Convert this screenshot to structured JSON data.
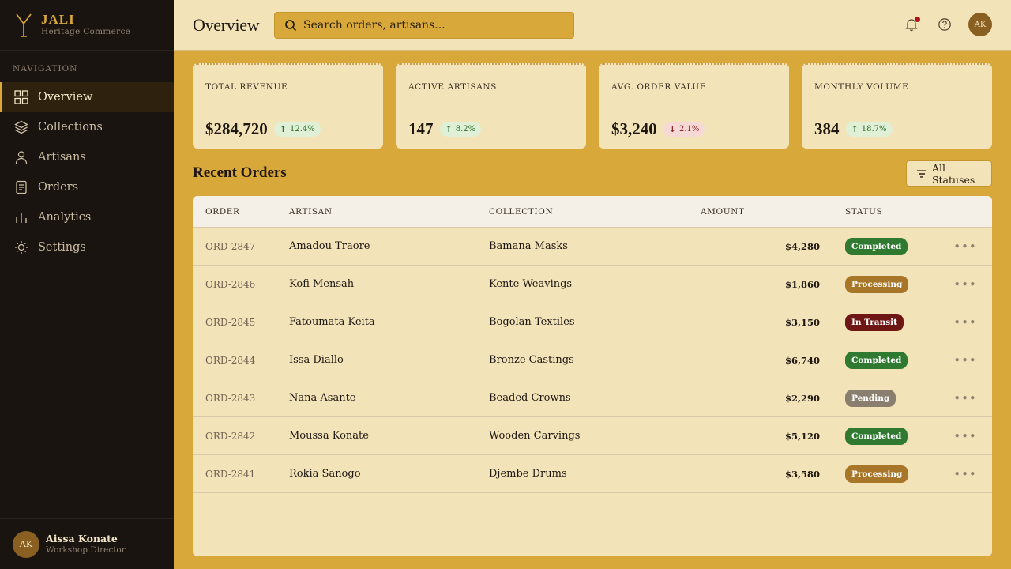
{
  "brand": {
    "name": "JALI",
    "subtitle": "Heritage Commerce"
  },
  "sidebar": {
    "heading": "NAVIGATION",
    "items": [
      {
        "label": "Overview",
        "icon": "grid-icon"
      },
      {
        "label": "Collections",
        "icon": "layers-icon"
      },
      {
        "label": "Artisans",
        "icon": "user-icon"
      },
      {
        "label": "Orders",
        "icon": "document-icon"
      },
      {
        "label": "Analytics",
        "icon": "bar-chart-icon"
      },
      {
        "label": "Settings",
        "icon": "sun-icon"
      }
    ],
    "active": "Overview"
  },
  "user": {
    "initials": "AK",
    "name": "Aissa Konate",
    "role": "Workshop Director"
  },
  "header": {
    "title": "Overview",
    "search_placeholder": "Search orders, artisans...",
    "avatar_initials": "AK"
  },
  "stats": [
    {
      "label": "TOTAL REVENUE",
      "value": "$284,720",
      "change": "12.4%",
      "direction": "up"
    },
    {
      "label": "ACTIVE ARTISANS",
      "value": "147",
      "change": "8.2%",
      "direction": "up"
    },
    {
      "label": "AVG. ORDER VALUE",
      "value": "$3,240",
      "change": "2.1%",
      "direction": "down"
    },
    {
      "label": "MONTHLY VOLUME",
      "value": "384",
      "change": "18.7%",
      "direction": "up"
    }
  ],
  "orders": {
    "title": "Recent Orders",
    "filter_label": "All Statuses",
    "columns": [
      "ORDER",
      "ARTISAN",
      "COLLECTION",
      "AMOUNT",
      "STATUS"
    ],
    "rows": [
      {
        "order": "ORD-2847",
        "artisan": "Amadou Traore",
        "collection": "Bamana Masks",
        "amount": "$4,280",
        "status": "Completed"
      },
      {
        "order": "ORD-2846",
        "artisan": "Kofi Mensah",
        "collection": "Kente Weavings",
        "amount": "$1,860",
        "status": "Processing"
      },
      {
        "order": "ORD-2845",
        "artisan": "Fatoumata Keita",
        "collection": "Bogolan Textiles",
        "amount": "$3,150",
        "status": "In Transit"
      },
      {
        "order": "ORD-2844",
        "artisan": "Issa Diallo",
        "collection": "Bronze Castings",
        "amount": "$6,740",
        "status": "Completed"
      },
      {
        "order": "ORD-2843",
        "artisan": "Nana Asante",
        "collection": "Beaded Crowns",
        "amount": "$2,290",
        "status": "Pending"
      },
      {
        "order": "ORD-2842",
        "artisan": "Moussa Konate",
        "collection": "Wooden Carvings",
        "amount": "$5,120",
        "status": "Completed"
      },
      {
        "order": "ORD-2841",
        "artisan": "Rokia Sanogo",
        "collection": "Djembe Drums",
        "amount": "$3,580",
        "status": "Processing"
      }
    ]
  },
  "status_colors": {
    "Completed": "#2f7a30",
    "Processing": "#a87628",
    "In Transit": "#6e1614",
    "Pending": "#8a7f6f"
  },
  "colors": {
    "accent": "#d9a83a",
    "sidebar_bg": "#1a1410",
    "surface": "#f3e3b8"
  }
}
